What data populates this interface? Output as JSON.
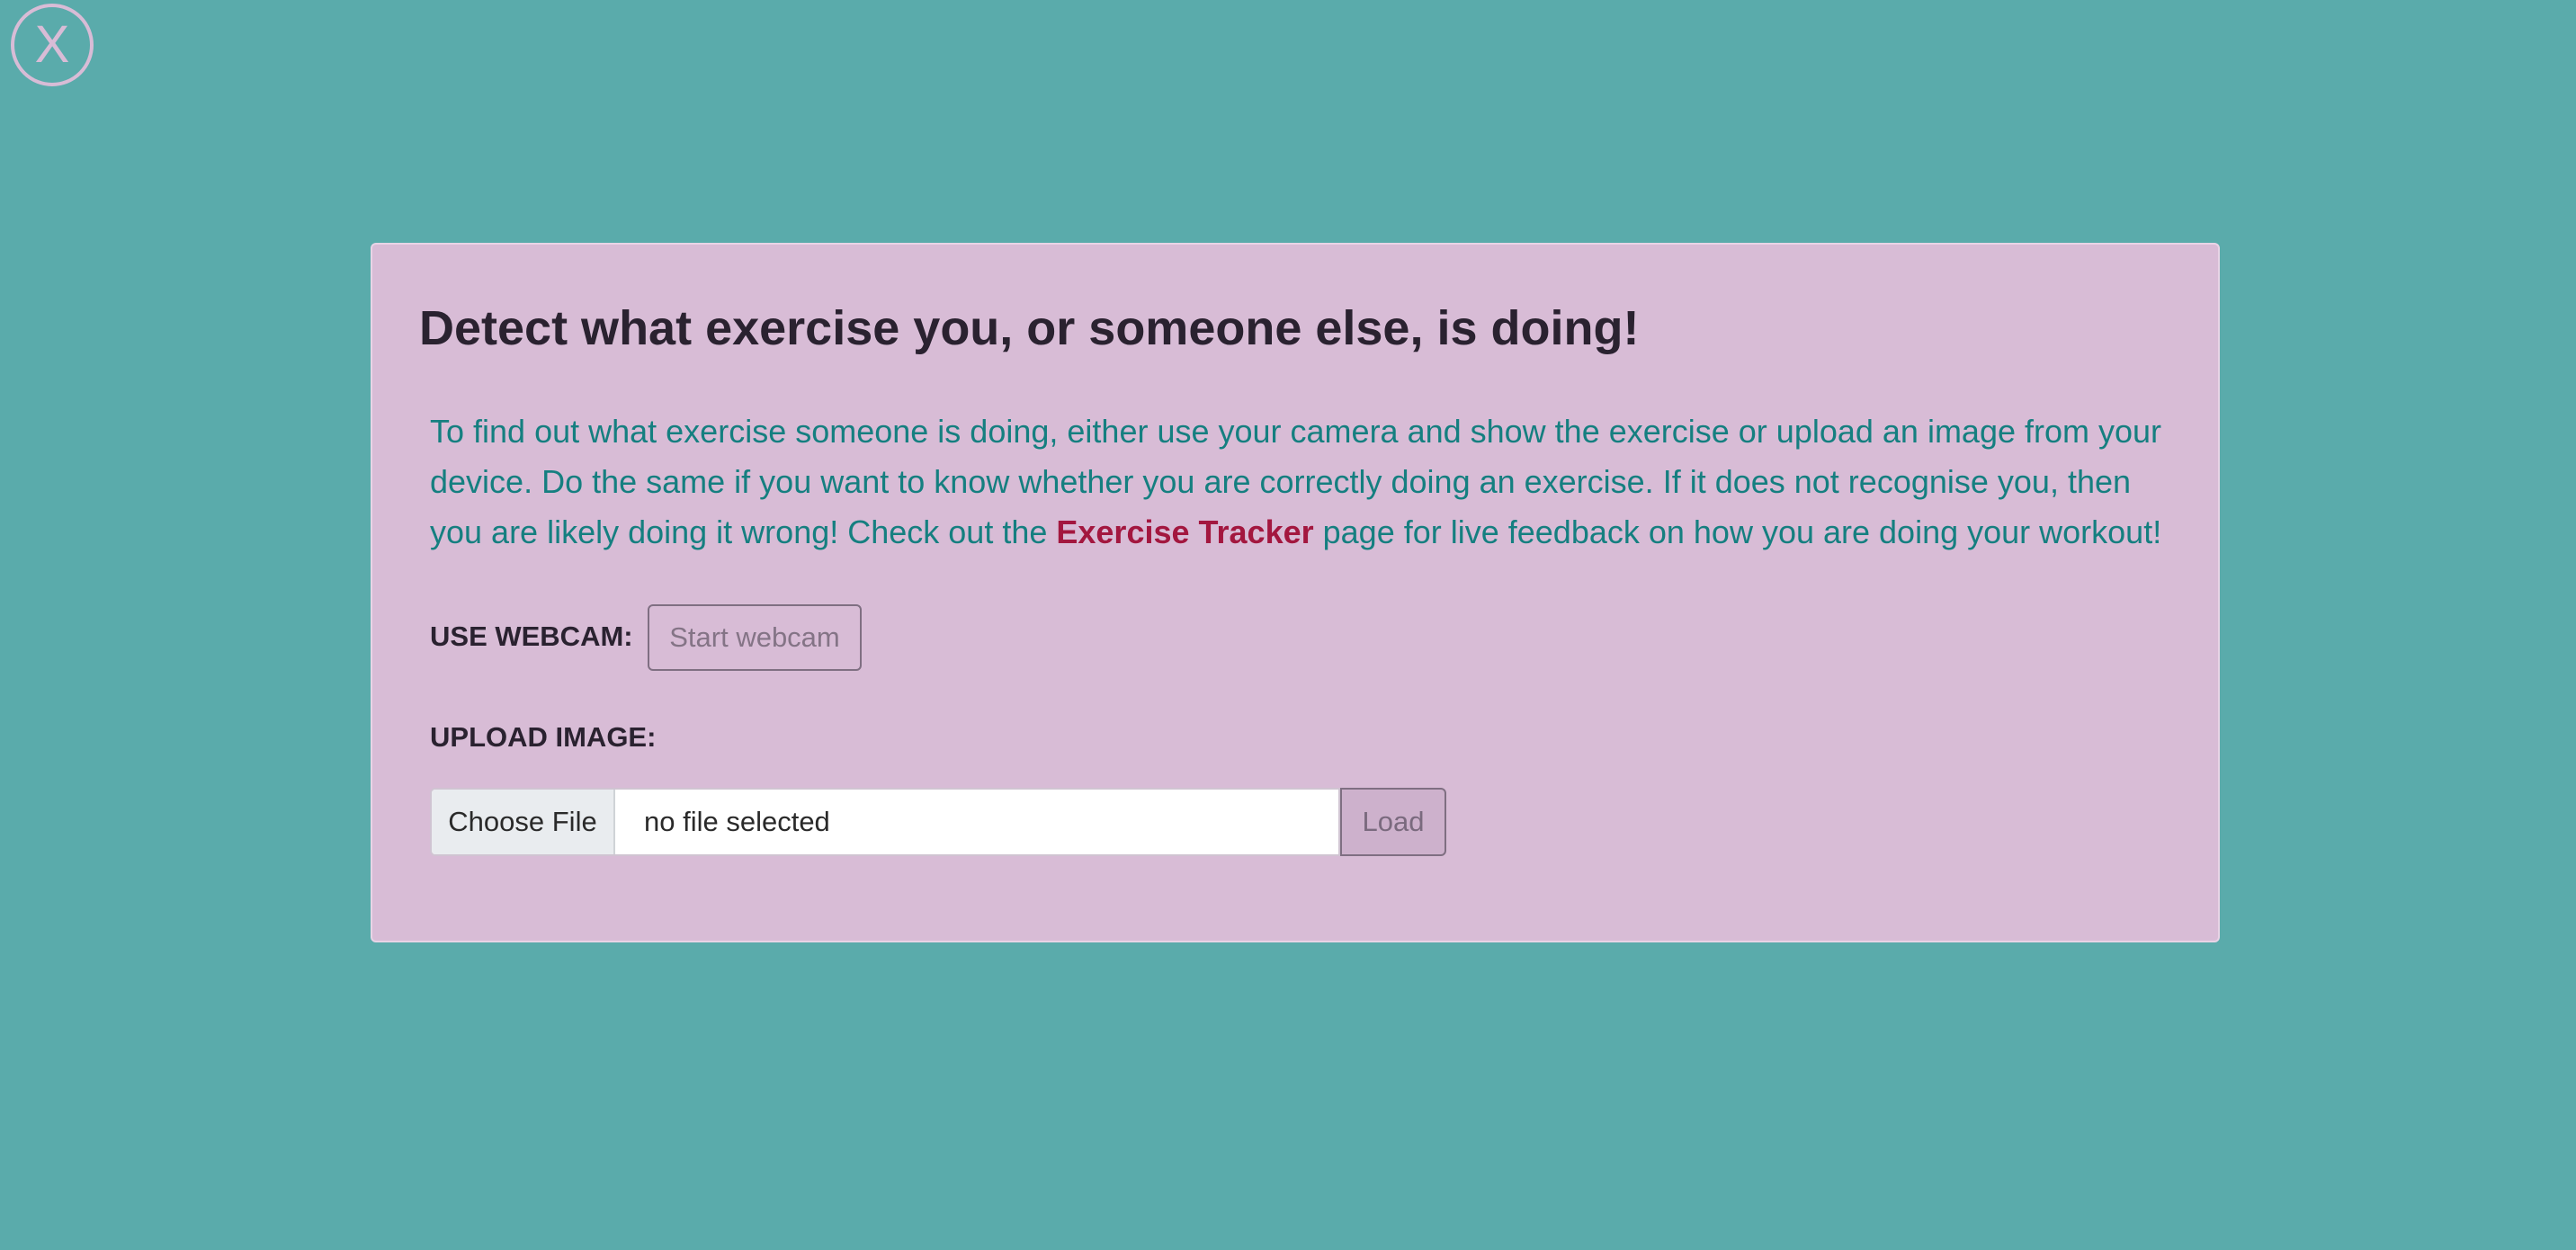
{
  "close_button": {
    "label": "X"
  },
  "card": {
    "title": "Detect what exercise you, or someone else, is doing!",
    "intro": {
      "text_before": "To find out what exercise someone is doing, either use your camera and show the exercise or upload an image from your device. Do the same if you want to know whether you are correctly doing an exercise. If it does not recognise you, then you are likely doing it wrong! Check out the ",
      "link_text": "Exercise Tracker",
      "text_after": " page for live feedback on how you are doing your workout!"
    },
    "webcam": {
      "label": "USE WEBCAM:",
      "button_label": "Start webcam"
    },
    "upload": {
      "label": "UPLOAD IMAGE:",
      "choose_label": "Choose File",
      "file_status": "no file selected",
      "load_label": "Load"
    }
  },
  "colors": {
    "background": "#5aabab",
    "card": "#d8bcd6",
    "intro_text": "#157f80",
    "link": "#a3173f",
    "heading": "#2a2230"
  }
}
